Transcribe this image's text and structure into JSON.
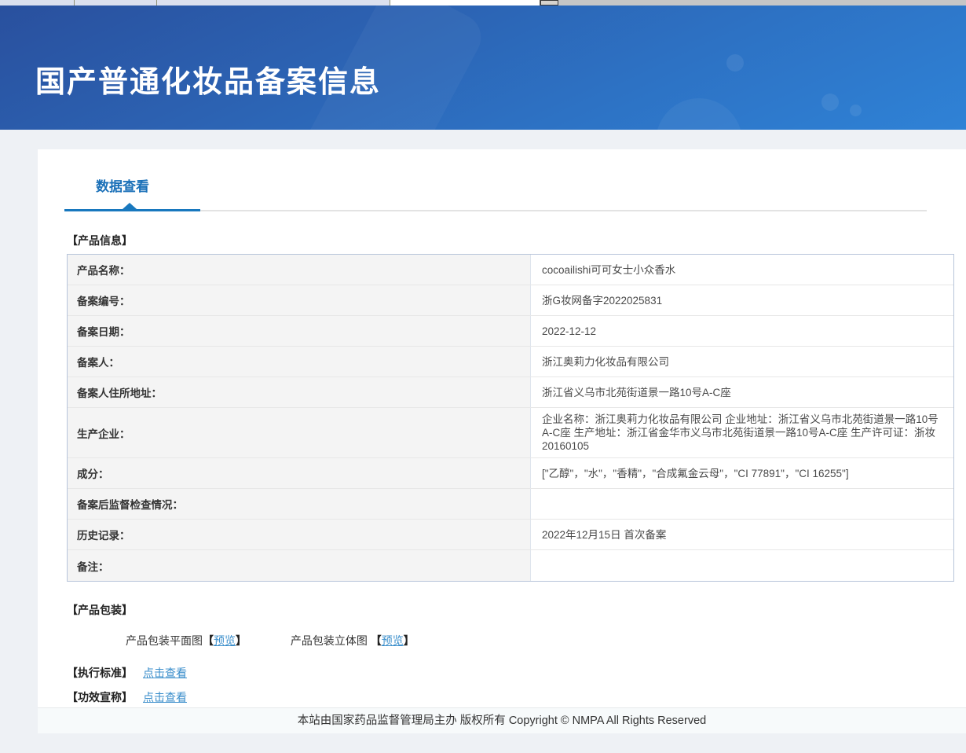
{
  "header": {
    "title": "国产普通化妆品备案信息"
  },
  "tabs": {
    "data_view": "数据查看"
  },
  "sections": {
    "product_info": "【产品信息】",
    "packaging": "【产品包装】",
    "standard": "【执行标准】",
    "efficacy": "【功效宣称】"
  },
  "product_table": {
    "rows": [
      {
        "label": "产品名称：",
        "value": "cocoailishi可可女士小众香水"
      },
      {
        "label": "备案编号：",
        "value": "浙G妆网备字2022025831"
      },
      {
        "label": "备案日期：",
        "value": "2022-12-12"
      },
      {
        "label": "备案人：",
        "value": "浙江奥莉力化妆品有限公司"
      },
      {
        "label": "备案人住所地址：",
        "value": "浙江省义乌市北苑街道景一路10号A-C座"
      },
      {
        "label": "生产企业：",
        "value": "企业名称：浙江奥莉力化妆品有限公司 企业地址：浙江省义乌市北苑街道景一路10号A-C座 生产地址：浙江省金华市义乌市北苑街道景一路10号A-C座 生产许可证：浙妆20160105"
      },
      {
        "label": "成分：",
        "value": "[\"乙醇\"，\"水\"，\"香精\"，\"合成氟金云母\"，\"CI 77891\"，\"CI 16255\"]"
      },
      {
        "label": "备案后监督检查情况：",
        "value": ""
      },
      {
        "label": "历史记录：",
        "value": "2022年12月15日 首次备案"
      },
      {
        "label": "备注：",
        "value": ""
      }
    ]
  },
  "packaging": {
    "flat_label": "产品包装平面图",
    "stereo_label": "产品包装立体图 ",
    "bracket_open": "【",
    "bracket_close": "】",
    "preview": "预览"
  },
  "links": {
    "click_to_view": "点击查看"
  },
  "footer": {
    "copyright": "本站由国家药品监督管理局主办 版权所有 Copyright © NMPA All Rights Reserved"
  },
  "colors": {
    "banner_gradient_start": "#29509e",
    "banner_gradient_end": "#2f82d6",
    "accent_blue": "#1878be",
    "link_blue": "#3a8ecb",
    "label_cell_bg": "#f4f4f4",
    "table_border": "#b7c4da",
    "page_bg": "#eef1f5"
  }
}
